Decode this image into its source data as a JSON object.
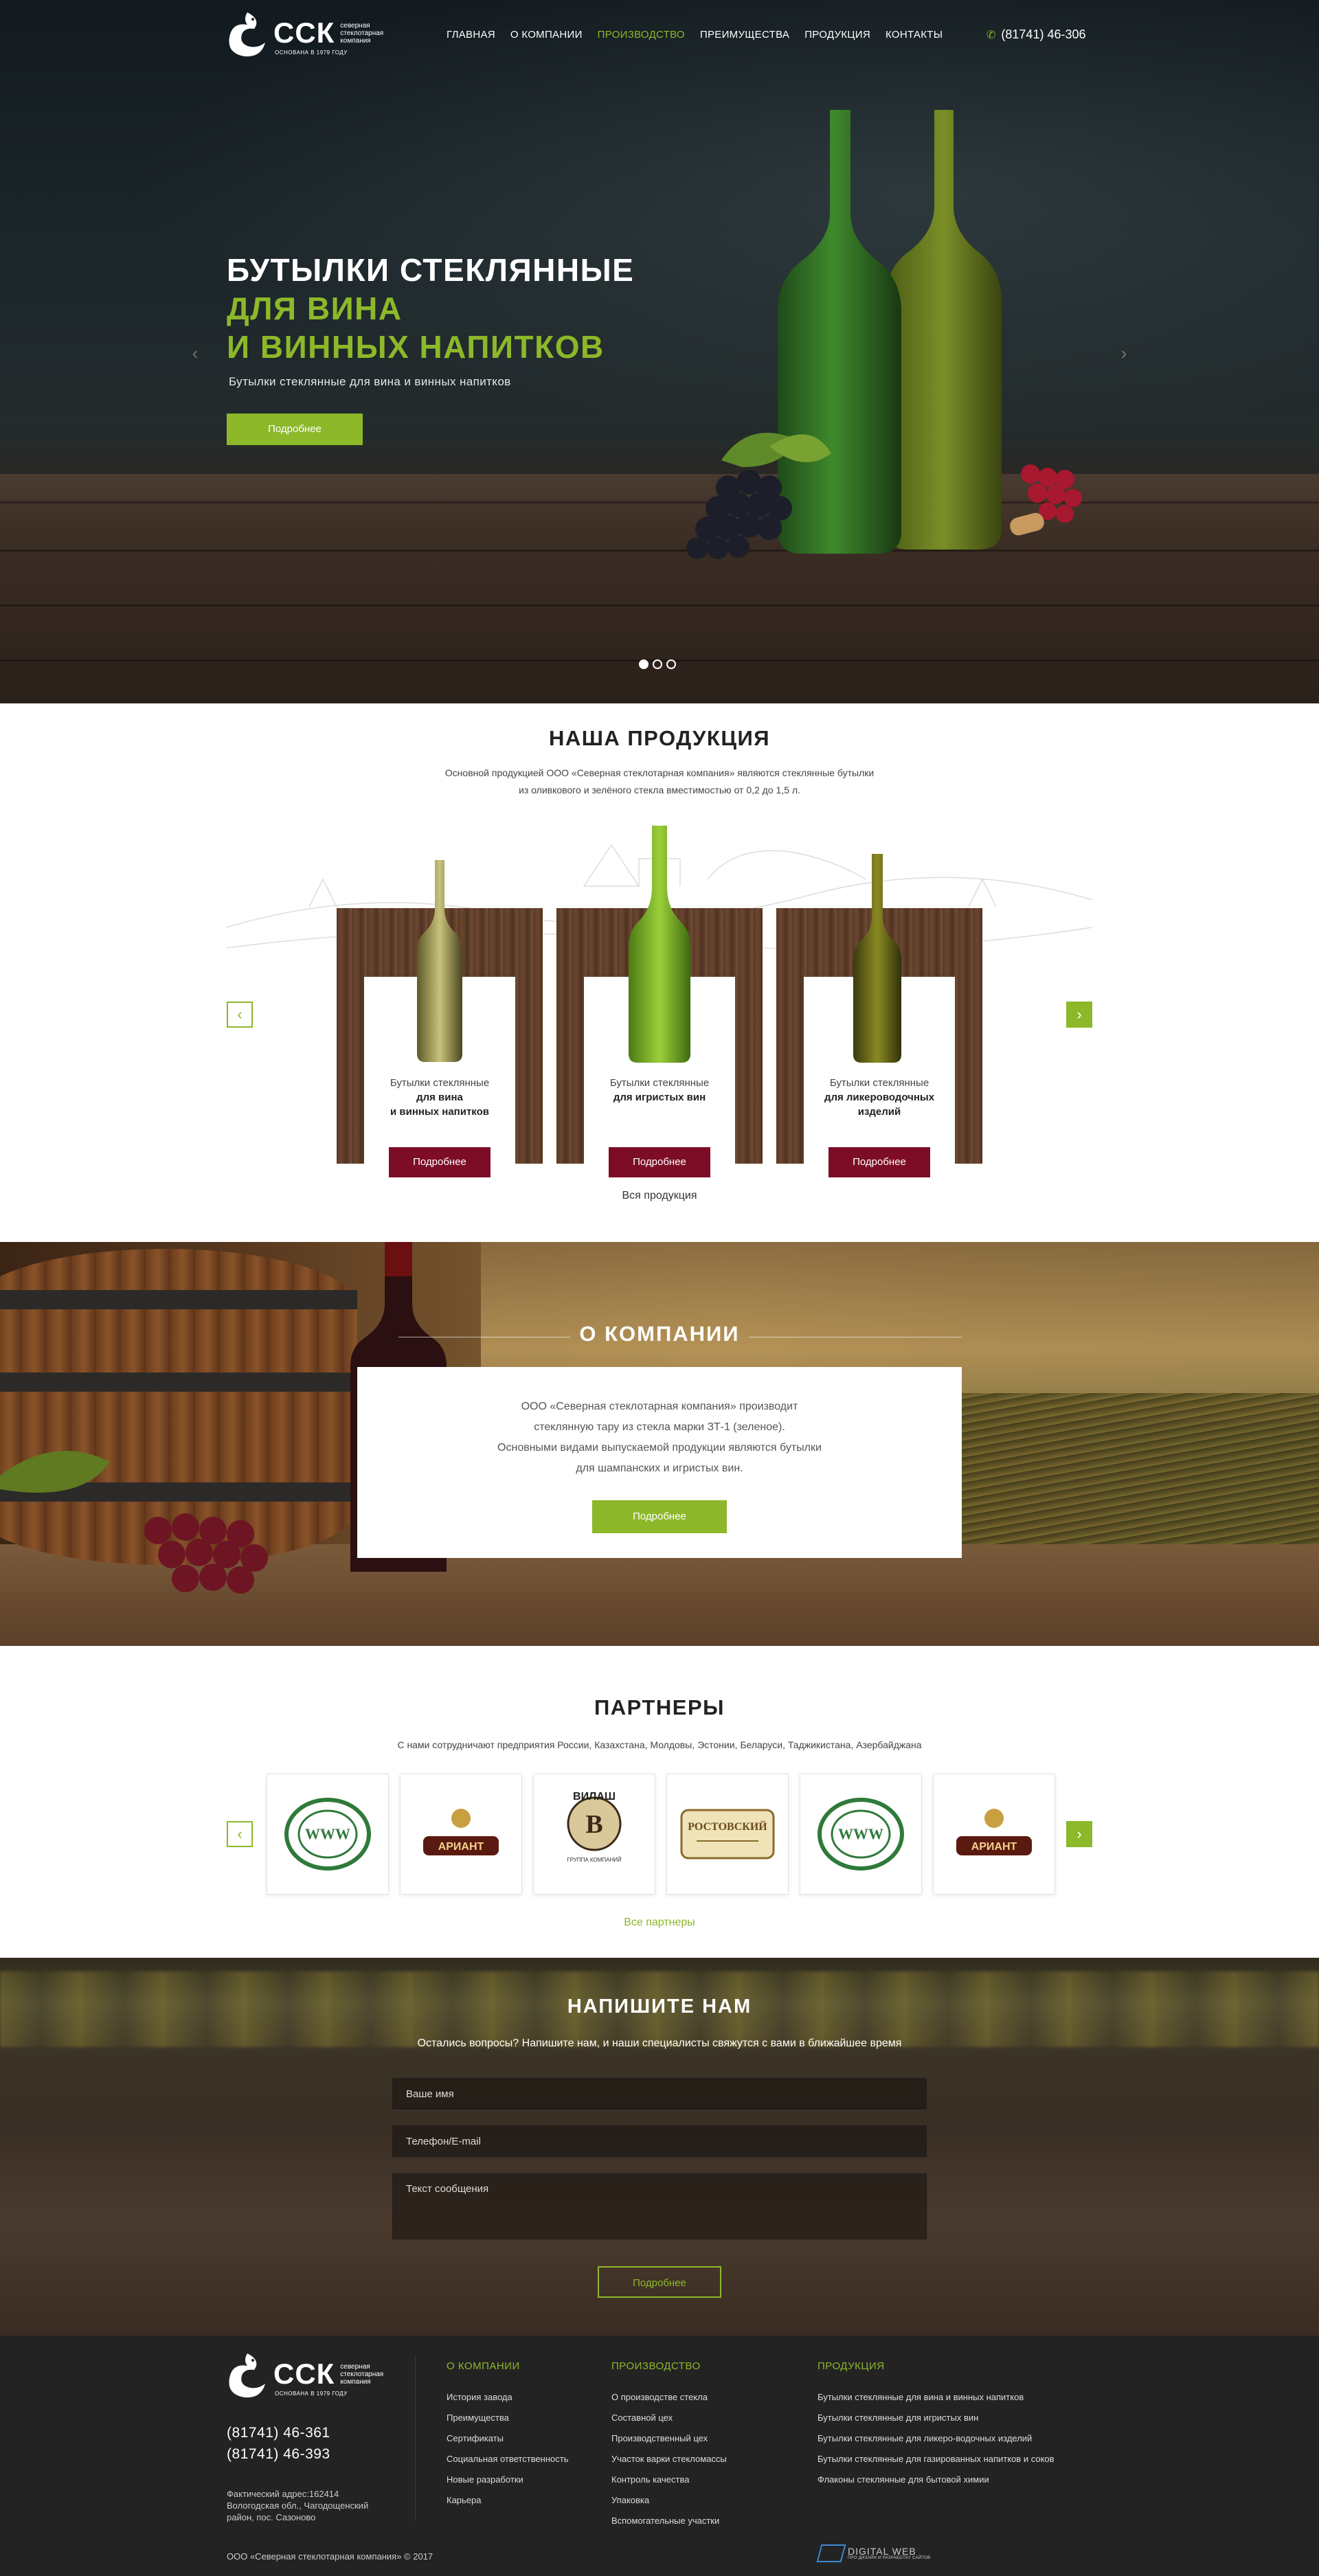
{
  "brand": {
    "name": "ССК",
    "sub": "северная стеклотарная компания",
    "tagline": "ОСНОВАНА В 1979 ГОДУ"
  },
  "nav": {
    "items": [
      {
        "label": "ГЛАВНАЯ"
      },
      {
        "label": "О КОМПАНИИ"
      },
      {
        "label": "ПРОИЗВОДСТВО",
        "active": true
      },
      {
        "label": "ПРЕИМУЩЕСТВА"
      },
      {
        "label": "ПРОДУКЦИЯ"
      },
      {
        "label": "КОНТАКТЫ"
      }
    ],
    "phone": "(81741) 46-306",
    "phone_icon": "phone-icon"
  },
  "hero": {
    "title_line1": "БУТЫЛКИ СТЕКЛЯННЫЕ",
    "title_line2": "ДЛЯ ВИНА",
    "title_line3": "И ВИННЫХ НАПИТКОВ",
    "subtitle": "Бутылки стеклянные для вина и винных напитков",
    "button": "Подробнее",
    "prev": "‹",
    "next": "›",
    "slides": 3,
    "active_slide": 1
  },
  "products": {
    "title": "НАША ПРОДУКЦИЯ",
    "desc_line1": "Основной продукцией ООО «Северная стеклотарная компания» являются стеклянные бутылки",
    "desc_line2": "из оливкового и зелёного стекла вместимостью от 0,2 до 1,5 л.",
    "prev": "‹",
    "next": "›",
    "cards": [
      {
        "line1": "Бутылки стеклянные",
        "line2": "для вина",
        "line3": "и винных напитков",
        "button": "Подробнее"
      },
      {
        "line1": "Бутылки стеклянные",
        "line2": "для игристых вин",
        "line3": "",
        "button": "Подробнее"
      },
      {
        "line1": "Бутылки стеклянные",
        "line2": "для ликероводочных",
        "line3": "изделий",
        "button": "Подробнее"
      }
    ],
    "all_link": "Вся продукция"
  },
  "about": {
    "title": "О КОМПАНИИ",
    "text_line1": "ООО «Северная стеклотарная компания» производит",
    "text_line2": "стеклянную тару из стекла марки ЗТ-1 (зеленое).",
    "text_line3": "Основными видами выпускаемой продукции являются бутылки",
    "text_line4": "для шампанских и игристых вин.",
    "button": "Подробнее"
  },
  "partners": {
    "title": "ПАРТНЕРЫ",
    "desc": "С нами сотрудничают предприятия России, Казахстана, Молдовы, Эстонии, Беларуси, Таджикистана, Азербайджана",
    "prev": "‹",
    "next": "›",
    "logos": [
      {
        "icon": "green-seal-logo"
      },
      {
        "icon": "ariant-logo",
        "text": "АРИАНТ"
      },
      {
        "icon": "vilash-logo",
        "text": "ВИЛАШ",
        "sub": "ГРУППА КОМПАНИЙ"
      },
      {
        "icon": "rostovsky-logo",
        "text": "РОСТОВСКИЙ"
      },
      {
        "icon": "green-seal-logo"
      },
      {
        "icon": "ariant-logo",
        "text": "АРИАНТ"
      }
    ],
    "all_link": "Все партнеры"
  },
  "contact": {
    "title": "НАПИШИТЕ НАМ",
    "desc": "Остались вопросы? Напишите нам, и наши специалисты свяжутся с вами в ближайшее время",
    "name_placeholder": "Ваше имя",
    "phone_placeholder": "Телефон/E-mail",
    "message_placeholder": "Текст сообщения",
    "button": "Подробнее"
  },
  "footer": {
    "phone1": "(81741) 46-361",
    "phone2": "(81741) 46-393",
    "address": "Фактический адрес:162414 Вологодская обл., Чагодощенский район, пос. Сазоново",
    "copyright": "ООО «Северная стеклотарная компания» © 2017",
    "col1": {
      "title": "О КОМПАНИИ",
      "items": [
        "История завода",
        "Преимущества",
        "Сертификаты",
        "Социальная ответственность",
        "Новые разработки",
        "Карьера"
      ]
    },
    "col2": {
      "title": "ПРОИЗВОДСТВО",
      "items": [
        "О производстве стекла",
        "Составной цех",
        "Производственный цех",
        "Участок варки стекломассы",
        "Контроль качества",
        "Упаковка",
        "Вспомогательные участки"
      ]
    },
    "col3": {
      "title": "ПРОДУКЦИЯ",
      "items": [
        "Бутылки стеклянные для вина и винных напитков",
        "Бутылки стеклянные для игристых вин",
        "Бутылки стеклянные для ликеро-водочных изделий",
        "Бутылки стеклянные для газированных напитков и соков",
        "Флаконы стеклянные для бытовой химии"
      ]
    },
    "developer": "DIGITAL WEB",
    "developer_tag": "ПРО ДИЗАЙН И РАЗРАБОТКУ САЙТОВ"
  },
  "colors": {
    "accent": "#8cb82a",
    "wine": "#7d0d26",
    "footer_bg": "#232323"
  }
}
